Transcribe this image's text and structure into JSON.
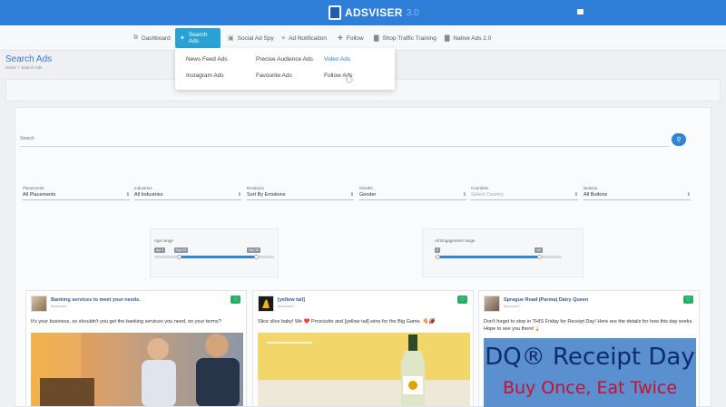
{
  "app": {
    "logo_text": "ADSVISER",
    "logo_suffix": "3.0"
  },
  "nav": [
    {
      "label": "Dashboard",
      "icon": "dashboard-icon",
      "glyph": "⧉"
    },
    {
      "label": "Search Ads",
      "icon": "search-ads-icon",
      "glyph": "✦"
    },
    {
      "label": "Social Ad Spy",
      "icon": "spy-icon",
      "glyph": "▣"
    },
    {
      "label": "Ad Notification",
      "icon": "notification-icon",
      "glyph": "≡"
    },
    {
      "label": "Follow",
      "icon": "follow-icon",
      "glyph": "✚"
    },
    {
      "label": "Shop Traffic Training",
      "icon": "chart-icon",
      "glyph": "▇"
    },
    {
      "label": "Native Ads 2.0",
      "icon": "native-ads-icon",
      "glyph": "▇"
    }
  ],
  "dropdown": {
    "items": [
      {
        "label": "News Feed Ads"
      },
      {
        "label": "Precise Audience Ads"
      },
      {
        "label": "Video Ads"
      },
      {
        "label": "Instagram Ads"
      },
      {
        "label": "Favourite Ads"
      },
      {
        "label": "Follow Ads"
      }
    ]
  },
  "page": {
    "title": "Search Ads",
    "breadcrumb": [
      "Home",
      "Search Ads"
    ]
  },
  "search": {
    "placeholder": "Search"
  },
  "filters": [
    {
      "label": "Placements",
      "value": "All Placements"
    },
    {
      "label": "Industries",
      "value": "All Industries"
    },
    {
      "label": "Emotions",
      "value": "Sort By Emotions"
    },
    {
      "label": "Gender",
      "value": "Gender"
    },
    {
      "label": "Countries",
      "value": "Select Country"
    },
    {
      "label": "Buttons",
      "value": "All Buttons"
    }
  ],
  "ranges": [
    {
      "label": "Age range",
      "tags": [
        "Apr 1",
        "Sep 23",
        "Sep 28"
      ]
    },
    {
      "label": "All Engagement range",
      "tags": [
        "0",
        "1M"
      ]
    }
  ],
  "cards": [
    {
      "title": "Banking services to meet your needs.",
      "sponsored": "Sponsored ·",
      "text": "It's your business, so shouldn't you get the banking services you need, on your terms?"
    },
    {
      "title": "[yellow tail]",
      "sponsored": "Sponsored ·",
      "text": "Slice slice baby! We ❤️ Prosciutto and [yellow tail] wine for the Big Game. 🍕🏈"
    },
    {
      "title": "Sprague Road (Parma) Dairy Queen",
      "sponsored": "Sponsored ·",
      "text": "Don't forget to stop in THIS Friday for Receipt Day! Here are the details for how this day works. Hope to see you there!🍦",
      "banner_title": "DQ® Receipt Day",
      "banner_sub": "Buy Once, Eat Twice"
    }
  ]
}
